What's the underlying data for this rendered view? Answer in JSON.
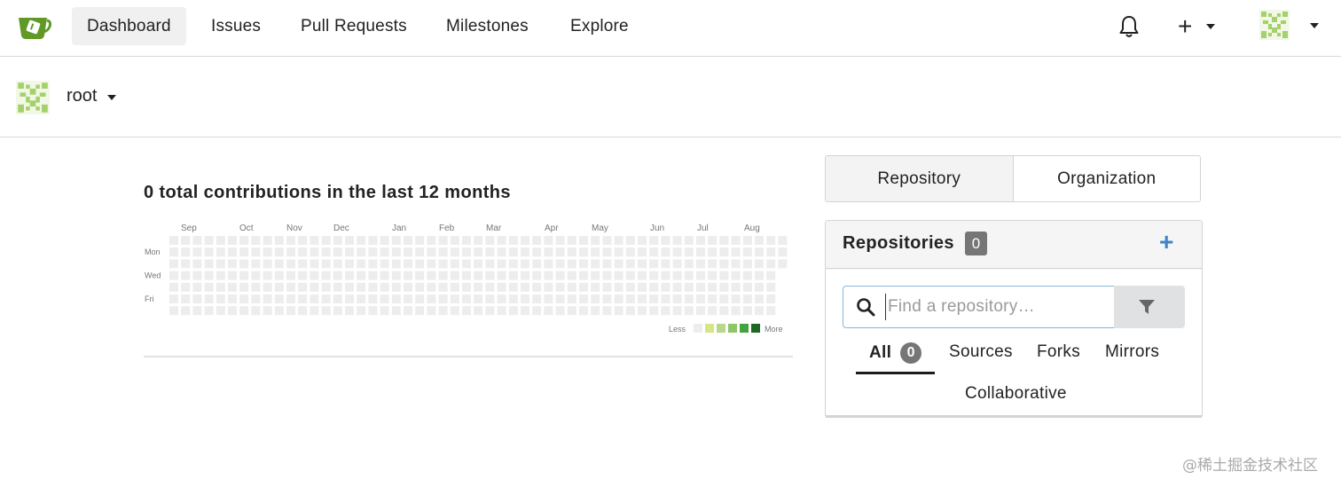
{
  "nav": {
    "items": [
      {
        "label": "Dashboard",
        "active": true
      },
      {
        "label": "Issues",
        "active": false
      },
      {
        "label": "Pull Requests",
        "active": false
      },
      {
        "label": "Milestones",
        "active": false
      },
      {
        "label": "Explore",
        "active": false
      }
    ],
    "icons": {
      "logo": "gitea-tea-cup-logo",
      "notifications": "bell-icon",
      "create": "plus-icon",
      "avatar": "identicon-avatar"
    }
  },
  "user": {
    "name": "root"
  },
  "heatmap": {
    "title": "0 total contributions in the last 12 months",
    "months": [
      "Sep",
      "Oct",
      "Nov",
      "Dec",
      "Jan",
      "Feb",
      "Mar",
      "Apr",
      "May",
      "Jun",
      "Jul",
      "Aug"
    ],
    "days": [
      "Mon",
      "Wed",
      "Fri"
    ],
    "legend_less": "Less",
    "legend_more": "More",
    "total": 0,
    "weeks": 53,
    "colors": {
      "empty": "#ededed",
      "l1": "#d6e685",
      "l2": "#8cc665",
      "l3": "#44a340",
      "l4": "#1e6823"
    },
    "legend_colors": [
      "#ededed",
      "#d6e685",
      "#b8d68c",
      "#8cc665",
      "#44a340",
      "#1e6823"
    ]
  },
  "panel": {
    "tabs": [
      {
        "label": "Repository",
        "active": true
      },
      {
        "label": "Organization",
        "active": false
      }
    ],
    "repositories": {
      "title": "Repositories",
      "count": "0",
      "search_placeholder": "Find a repository…",
      "filters": [
        {
          "label": "All",
          "count": "0",
          "active": true
        },
        {
          "label": "Sources"
        },
        {
          "label": "Forks"
        },
        {
          "label": "Mirrors"
        },
        {
          "label": "Collaborative"
        }
      ]
    }
  },
  "watermark": "@稀土掘金技术社区",
  "colors": {
    "accent": "#4183c4",
    "badge": "#767676",
    "focus_border": "#85b7d9"
  }
}
